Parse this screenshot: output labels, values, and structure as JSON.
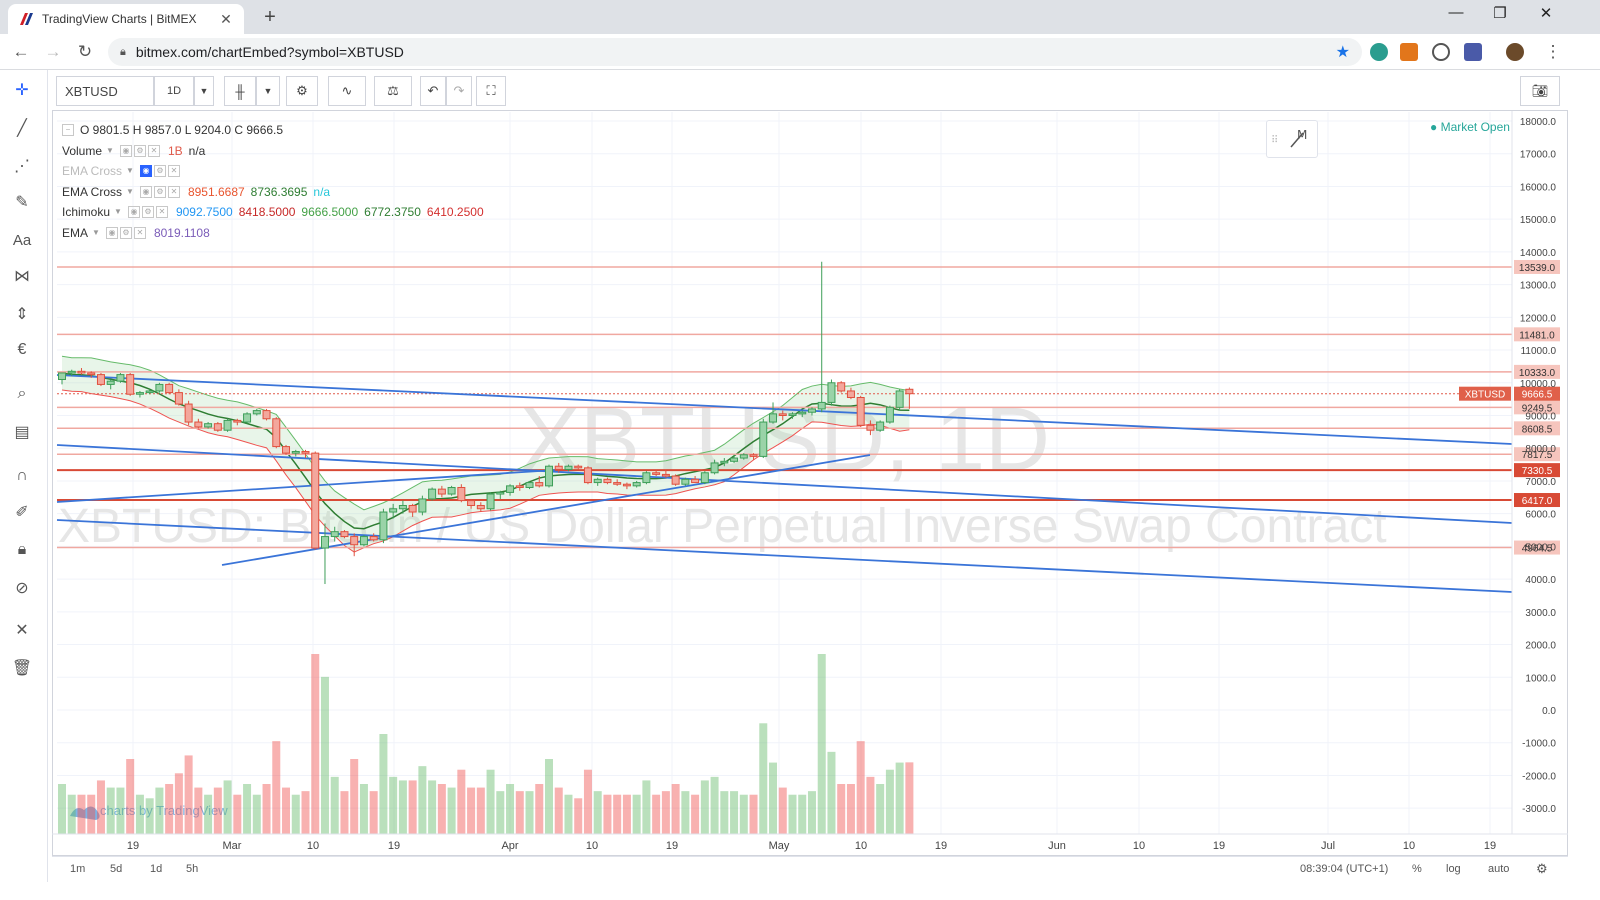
{
  "browser": {
    "tab_title": "TradingView Charts | BitMEX",
    "url": "bitmex.com/chartEmbed?symbol=XBTUSD"
  },
  "toolbar": {
    "symbol": "XBTUSD",
    "interval": "1D"
  },
  "legend": {
    "ohlc": "O 9801.5  H 9857.0  L 9204.0  C 9666.5",
    "volume_name": "Volume",
    "volume_values": [
      "1B",
      "n/a"
    ],
    "ema_cross_hidden_name": "EMA Cross",
    "ema_cross_name": "EMA Cross",
    "ema_cross_values": [
      "8951.6687",
      "8736.3695",
      "n/a"
    ],
    "ichimoku_name": "Ichimoku",
    "ichimoku_values": [
      "9092.7500",
      "8418.5000",
      "9666.5000",
      "6772.3750",
      "6410.2500"
    ],
    "ema_name": "EMA",
    "ema_values": [
      "8019.1108"
    ]
  },
  "market_status": "Market Open",
  "watermark": {
    "symbol": "XBTUSD, 1D",
    "description": "XBTUSD: Bitcoin / US Dollar Perpetual Inverse Swap Contract"
  },
  "branding": "charts by TradingView",
  "bottom": {
    "ranges": [
      "1m",
      "5d",
      "1d",
      "5h"
    ],
    "time": "08:39:04 (UTC+1)",
    "percent": "%",
    "log": "log",
    "auto": "auto"
  },
  "chart_data": {
    "type": "candlestick",
    "price_axis_ticks": [
      "18000.0",
      "17000.0",
      "16000.0",
      "15000.0",
      "14000.0",
      "13000.0",
      "12000.0",
      "11000.0",
      "10000.0",
      "9000.0",
      "8000.0",
      "7000.0",
      "6000.0",
      "5000.0",
      "4000.0",
      "3000.0",
      "2000.0",
      "1000.0",
      "0.0",
      "-1000.0",
      "-2000.0",
      "-3000.0"
    ],
    "time_axis_labels": [
      "19",
      "Mar",
      "10",
      "19",
      "Apr",
      "10",
      "19",
      "May",
      "10",
      "19",
      "Jun",
      "10",
      "19",
      "Jul",
      "10",
      "19"
    ],
    "horizontal_levels": [
      {
        "label": "13539.0",
        "color": "#f0a8a0"
      },
      {
        "label": "11481.0",
        "color": "#f0a8a0"
      },
      {
        "label": "10333.0",
        "color": "#f0a8a0"
      },
      {
        "label": "9249.5",
        "color": "#f0a8a0"
      },
      {
        "label": "8608.5",
        "color": "#f0a8a0"
      },
      {
        "label": "7817.5",
        "color": "#f0a8a0"
      },
      {
        "label": "7330.5",
        "color": "#d84a35"
      },
      {
        "label": "6417.0",
        "color": "#d84a35"
      },
      {
        "label": "4964.5",
        "color": "#f0a8a0"
      }
    ],
    "last_price_label": "XBTUSD",
    "last_price": "9666.5",
    "last_price_value": 9666.5,
    "candles": [
      {
        "o": 10100,
        "h": 10300,
        "l": 9950,
        "c": 10300
      },
      {
        "o": 10300,
        "h": 10400,
        "l": 10200,
        "c": 10350
      },
      {
        "o": 10350,
        "h": 10450,
        "l": 10250,
        "c": 10300
      },
      {
        "o": 10300,
        "h": 10350,
        "l": 10150,
        "c": 10250
      },
      {
        "o": 10250,
        "h": 10300,
        "l": 9900,
        "c": 9950
      },
      {
        "o": 9950,
        "h": 10100,
        "l": 9800,
        "c": 10050
      },
      {
        "o": 10050,
        "h": 10300,
        "l": 10000,
        "c": 10250
      },
      {
        "o": 10250,
        "h": 10300,
        "l": 9600,
        "c": 9650
      },
      {
        "o": 9650,
        "h": 9750,
        "l": 9550,
        "c": 9700
      },
      {
        "o": 9700,
        "h": 9800,
        "l": 9650,
        "c": 9750
      },
      {
        "o": 9750,
        "h": 10000,
        "l": 9700,
        "c": 9950
      },
      {
        "o": 9950,
        "h": 10000,
        "l": 9650,
        "c": 9700
      },
      {
        "o": 9700,
        "h": 9800,
        "l": 9300,
        "c": 9350
      },
      {
        "o": 9350,
        "h": 9450,
        "l": 8700,
        "c": 8800
      },
      {
        "o": 8800,
        "h": 8900,
        "l": 8600,
        "c": 8650
      },
      {
        "o": 8650,
        "h": 8800,
        "l": 8600,
        "c": 8750
      },
      {
        "o": 8750,
        "h": 8800,
        "l": 8500,
        "c": 8550
      },
      {
        "o": 8550,
        "h": 8900,
        "l": 8500,
        "c": 8850
      },
      {
        "o": 8850,
        "h": 8900,
        "l": 8700,
        "c": 8800
      },
      {
        "o": 8800,
        "h": 9100,
        "l": 8750,
        "c": 9050
      },
      {
        "o": 9050,
        "h": 9200,
        "l": 9000,
        "c": 9150
      },
      {
        "o": 9150,
        "h": 9200,
        "l": 8850,
        "c": 8900
      },
      {
        "o": 8900,
        "h": 8950,
        "l": 8000,
        "c": 8050
      },
      {
        "o": 8050,
        "h": 8100,
        "l": 7800,
        "c": 7850
      },
      {
        "o": 7850,
        "h": 7950,
        "l": 7750,
        "c": 7900
      },
      {
        "o": 7900,
        "h": 7950,
        "l": 7700,
        "c": 7850
      },
      {
        "o": 7850,
        "h": 7900,
        "l": 4900,
        "c": 4950
      },
      {
        "o": 4950,
        "h": 5700,
        "l": 3850,
        "c": 5300
      },
      {
        "o": 5300,
        "h": 5600,
        "l": 5150,
        "c": 5450
      },
      {
        "o": 5450,
        "h": 5500,
        "l": 5250,
        "c": 5300
      },
      {
        "o": 5300,
        "h": 5400,
        "l": 4700,
        "c": 5050
      },
      {
        "o": 5050,
        "h": 5350,
        "l": 5000,
        "c": 5300
      },
      {
        "o": 5300,
        "h": 5400,
        "l": 5150,
        "c": 5200
      },
      {
        "o": 5200,
        "h": 6150,
        "l": 5100,
        "c": 6050
      },
      {
        "o": 6050,
        "h": 6300,
        "l": 5850,
        "c": 6150
      },
      {
        "o": 6150,
        "h": 6400,
        "l": 6000,
        "c": 6250
      },
      {
        "o": 6250,
        "h": 6300,
        "l": 5900,
        "c": 6050
      },
      {
        "o": 6050,
        "h": 6550,
        "l": 5950,
        "c": 6450
      },
      {
        "o": 6450,
        "h": 6800,
        "l": 6400,
        "c": 6750
      },
      {
        "o": 6750,
        "h": 6850,
        "l": 6500,
        "c": 6600
      },
      {
        "o": 6600,
        "h": 6850,
        "l": 6550,
        "c": 6800
      },
      {
        "o": 6800,
        "h": 6900,
        "l": 6350,
        "c": 6400
      },
      {
        "o": 6400,
        "h": 6450,
        "l": 6150,
        "c": 6250
      },
      {
        "o": 6250,
        "h": 6350,
        "l": 6050,
        "c": 6150
      },
      {
        "o": 6150,
        "h": 6650,
        "l": 6100,
        "c": 6600
      },
      {
        "o": 6600,
        "h": 6700,
        "l": 6450,
        "c": 6650
      },
      {
        "o": 6650,
        "h": 6900,
        "l": 6550,
        "c": 6850
      },
      {
        "o": 6850,
        "h": 6950,
        "l": 6700,
        "c": 6800
      },
      {
        "o": 6800,
        "h": 7000,
        "l": 6750,
        "c": 6950
      },
      {
        "o": 6950,
        "h": 7150,
        "l": 6800,
        "c": 6850
      },
      {
        "o": 6850,
        "h": 7500,
        "l": 6800,
        "c": 7450
      },
      {
        "o": 7450,
        "h": 7550,
        "l": 7250,
        "c": 7350
      },
      {
        "o": 7350,
        "h": 7500,
        "l": 7300,
        "c": 7450
      },
      {
        "o": 7450,
        "h": 7500,
        "l": 7350,
        "c": 7400
      },
      {
        "o": 7400,
        "h": 7450,
        "l": 6900,
        "c": 6950
      },
      {
        "o": 6950,
        "h": 7100,
        "l": 6850,
        "c": 7050
      },
      {
        "o": 7050,
        "h": 7100,
        "l": 6900,
        "c": 6950
      },
      {
        "o": 6950,
        "h": 7050,
        "l": 6850,
        "c": 6900
      },
      {
        "o": 6900,
        "h": 6950,
        "l": 6750,
        "c": 6850
      },
      {
        "o": 6850,
        "h": 7000,
        "l": 6800,
        "c": 6950
      },
      {
        "o": 6950,
        "h": 7300,
        "l": 6900,
        "c": 7250
      },
      {
        "o": 7250,
        "h": 7350,
        "l": 7150,
        "c": 7200
      },
      {
        "o": 7200,
        "h": 7350,
        "l": 7100,
        "c": 7150
      },
      {
        "o": 7150,
        "h": 7200,
        "l": 6850,
        "c": 6900
      },
      {
        "o": 6900,
        "h": 7100,
        "l": 6850,
        "c": 7050
      },
      {
        "o": 7050,
        "h": 7150,
        "l": 6950,
        "c": 6950
      },
      {
        "o": 6950,
        "h": 7300,
        "l": 6900,
        "c": 7250
      },
      {
        "o": 7250,
        "h": 7650,
        "l": 7200,
        "c": 7550
      },
      {
        "o": 7550,
        "h": 7700,
        "l": 7450,
        "c": 7600
      },
      {
        "o": 7600,
        "h": 7800,
        "l": 7550,
        "c": 7700
      },
      {
        "o": 7700,
        "h": 7850,
        "l": 7650,
        "c": 7800
      },
      {
        "o": 7800,
        "h": 7850,
        "l": 7650,
        "c": 7750
      },
      {
        "o": 7750,
        "h": 8900,
        "l": 7700,
        "c": 8800
      },
      {
        "o": 8800,
        "h": 9400,
        "l": 8750,
        "c": 9050
      },
      {
        "o": 9050,
        "h": 9150,
        "l": 8850,
        "c": 9000
      },
      {
        "o": 9000,
        "h": 9100,
        "l": 8900,
        "c": 9050
      },
      {
        "o": 9050,
        "h": 9150,
        "l": 8950,
        "c": 9100
      },
      {
        "o": 9100,
        "h": 9250,
        "l": 9000,
        "c": 9200
      },
      {
        "o": 9200,
        "h": 13700,
        "l": 9100,
        "c": 9400
      },
      {
        "o": 9400,
        "h": 10100,
        "l": 9300,
        "c": 10000
      },
      {
        "o": 10000,
        "h": 10050,
        "l": 9700,
        "c": 9750
      },
      {
        "o": 9750,
        "h": 9850,
        "l": 9500,
        "c": 9550
      },
      {
        "o": 9550,
        "h": 9600,
        "l": 8650,
        "c": 8700
      },
      {
        "o": 8700,
        "h": 8850,
        "l": 8400,
        "c": 8550
      },
      {
        "o": 8550,
        "h": 8850,
        "l": 8500,
        "c": 8800
      },
      {
        "o": 8800,
        "h": 9300,
        "l": 8750,
        "c": 9250
      },
      {
        "o": 9250,
        "h": 9800,
        "l": 9150,
        "c": 9750
      },
      {
        "o": 9801.5,
        "h": 9857,
        "l": 9204,
        "c": 9666.5
      }
    ],
    "volume_series_name": "Volume"
  }
}
